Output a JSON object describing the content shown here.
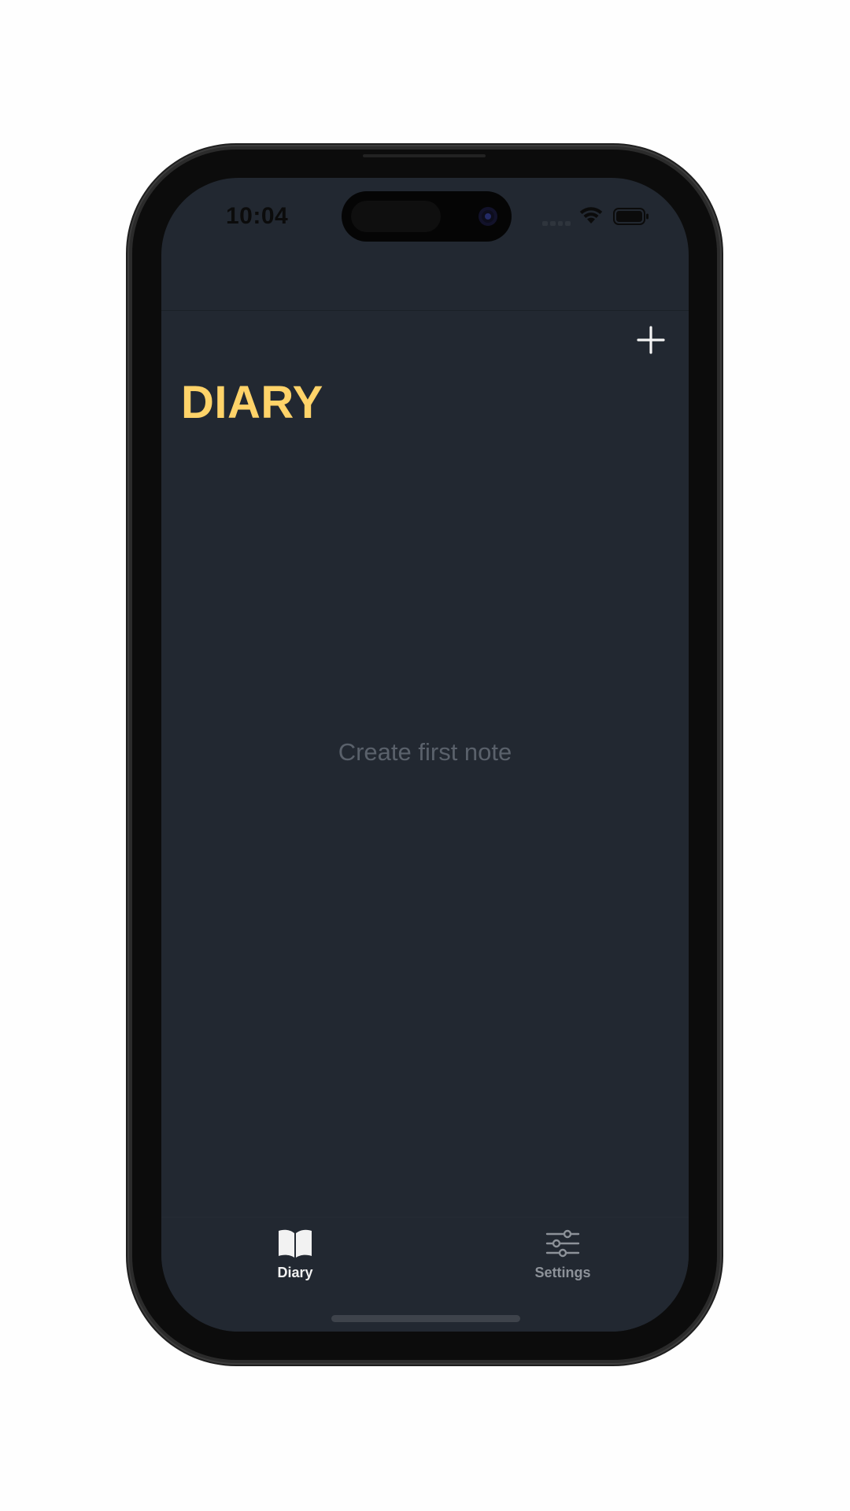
{
  "status_bar": {
    "time": "10:04"
  },
  "header": {
    "title": "DIARY",
    "add_icon": "plus-icon"
  },
  "main": {
    "empty_message": "Create first note"
  },
  "tab_bar": {
    "tabs": [
      {
        "label": "Diary",
        "icon": "book-icon",
        "active": true
      },
      {
        "label": "Settings",
        "icon": "sliders-icon",
        "active": false
      }
    ]
  },
  "colors": {
    "background": "#222831",
    "accent": "#ffd369",
    "placeholder_text": "#5a616b",
    "active_tab": "#f2f2f2",
    "inactive_tab": "#8d9299"
  }
}
